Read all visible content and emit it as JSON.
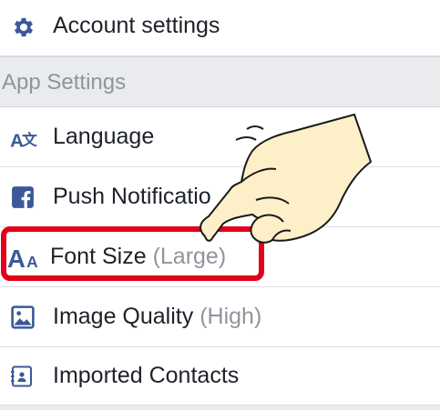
{
  "account": {
    "label": "Account settings",
    "icon": "gear-icon"
  },
  "app_settings": {
    "header": "App Settings",
    "items": [
      {
        "label": "Language",
        "suffix": "",
        "icon": "translate-icon"
      },
      {
        "label": "Push Notificatio",
        "suffix": "",
        "icon": "facebook-icon"
      },
      {
        "label": "Font Size",
        "suffix": "(Large)",
        "icon": "font-size-icon"
      },
      {
        "label": "Image Quality",
        "suffix": "(High)",
        "icon": "image-icon"
      },
      {
        "label": "Imported Contacts",
        "suffix": "",
        "icon": "contacts-icon"
      }
    ]
  },
  "colors": {
    "accent": "#3b5998",
    "highlight": "#e3001b",
    "section_bg": "#e9ebee",
    "muted_text": "#90949c"
  }
}
